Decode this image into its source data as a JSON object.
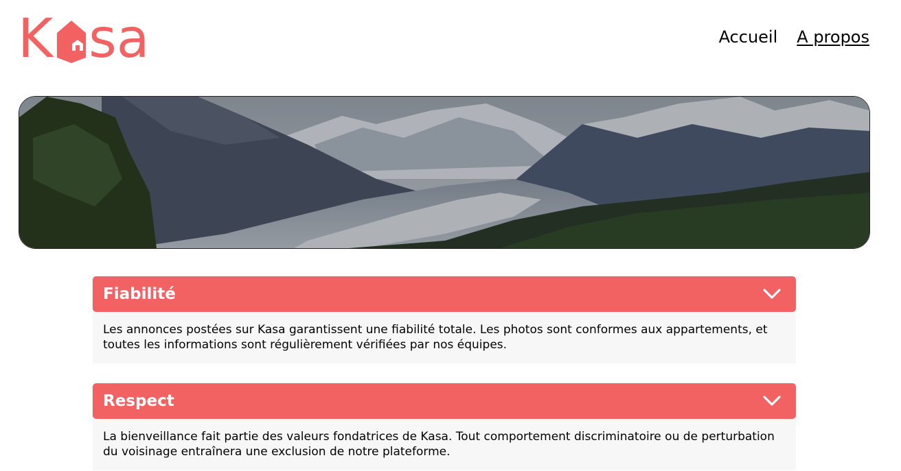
{
  "brand": {
    "logo_letters_left": "K",
    "logo_letters_right": "sa",
    "logo_icon": "house-icon",
    "accent_color": "#F26262"
  },
  "nav": {
    "items": [
      {
        "label": "Accueil"
      },
      {
        "label": "A propos"
      }
    ]
  },
  "banner": {
    "image": "mountain-landscape"
  },
  "sections": [
    {
      "title": "Fiabilité",
      "icon": "chevron-down-icon",
      "text": "Les annonces postées sur Kasa garantissent une fiabilité totale. Les photos sont conformes aux appartements, et toutes les informations sont régulièrement vérifiées par nos équipes."
    },
    {
      "title": "Respect",
      "icon": "chevron-down-icon",
      "text": "La bienveillance fait partie des valeurs fondatrices de Kasa. Tout comportement discriminatoire ou de perturbation du voisinage entraînera une exclusion de notre plateforme."
    }
  ]
}
